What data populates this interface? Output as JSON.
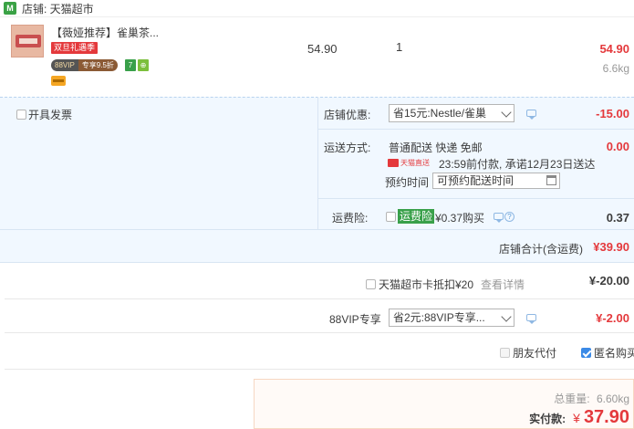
{
  "store": {
    "label": "店铺: 天猫超市",
    "badge": "M"
  },
  "item": {
    "title": "【薇娅推荐】雀巢茶...",
    "promo_tag": "双旦礼遇季",
    "vip_left": "88VIP",
    "vip_right": "专享9.5折",
    "icon_seven": "7",
    "icon_green": "⊕",
    "unit_price": "54.90",
    "quantity": "1",
    "subtotal": "54.90",
    "weight": "6.6kg"
  },
  "invoice": {
    "label": "开具发票"
  },
  "store_discount": {
    "label": "店铺优惠:",
    "selected": "省15元:Nestle/雀巢",
    "amount": "-15.00"
  },
  "shipping": {
    "label": "运送方式:",
    "method": "普通配送 快递 免邮",
    "amount": "0.00",
    "express_brand": "天猫直送",
    "promise": "23:59前付款, 承诺12月23日送达",
    "reserve_label": "预约时间",
    "reserve_placeholder": "可预约配送时间"
  },
  "insurance": {
    "label": "运费险:",
    "tag": "运费险",
    "text": "¥0.37购买",
    "help": "?",
    "amount": "0.37"
  },
  "store_total": {
    "label": "店铺合计(含运费)",
    "amount": "¥39.90"
  },
  "card_deduct": {
    "label": "天猫超市卡抵扣¥20",
    "link": "查看详情",
    "amount": "¥-20.00"
  },
  "vip_discount": {
    "label": "88VIP专享",
    "selected": "省2元:88VIP专享...",
    "amount": "¥-2.00"
  },
  "options": {
    "friend_pay": "朋友代付",
    "anonymous": "匿名购买"
  },
  "summary": {
    "weight_label": "总重量:",
    "weight": "6.60kg",
    "pay_label": "实付款:",
    "currency": "¥",
    "pay": "37.90"
  },
  "colors": {
    "accent_red": "#e4393c",
    "panel_blue": "#f1f8ff",
    "tmall_green": "#3aa245"
  }
}
